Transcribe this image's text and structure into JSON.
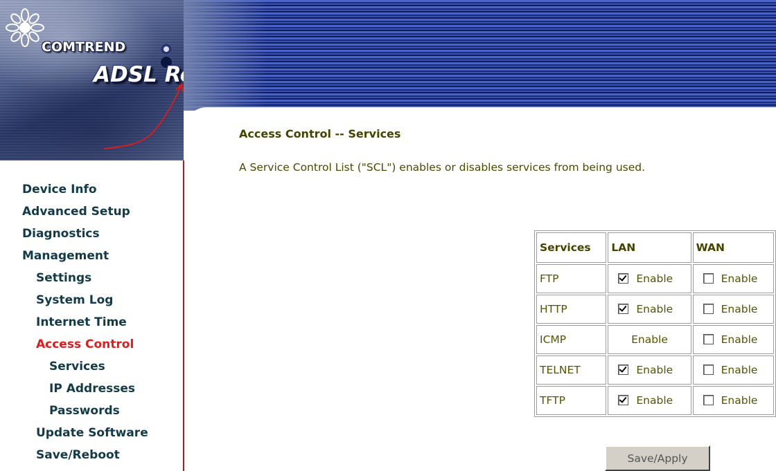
{
  "banner": {
    "brand": "COMTREND",
    "product": "ADSL Router"
  },
  "colors": {
    "nav_text": "#123a48",
    "nav_active": "#e31b1b",
    "content_text": "#4a4a00",
    "sidebar_border": "#b11a1a",
    "stripe_dark": "#1a2b7a",
    "stripe_light": "#4a63c6"
  },
  "sidebar": {
    "items": [
      {
        "label": "Device Info",
        "level": 0,
        "active": false
      },
      {
        "label": "Advanced Setup",
        "level": 0,
        "active": false
      },
      {
        "label": "Diagnostics",
        "level": 0,
        "active": false
      },
      {
        "label": "Management",
        "level": 0,
        "active": false
      },
      {
        "label": "Settings",
        "level": 1,
        "active": false
      },
      {
        "label": "System Log",
        "level": 1,
        "active": false
      },
      {
        "label": "Internet Time",
        "level": 1,
        "active": false
      },
      {
        "label": "Access Control",
        "level": 1,
        "active": true
      },
      {
        "label": "Services",
        "level": 2,
        "active": false
      },
      {
        "label": "IP Addresses",
        "level": 2,
        "active": false
      },
      {
        "label": "Passwords",
        "level": 2,
        "active": false
      },
      {
        "label": "Update Software",
        "level": 1,
        "active": false
      },
      {
        "label": "Save/Reboot",
        "level": 1,
        "active": false
      }
    ]
  },
  "main": {
    "title": "Access Control -- Services",
    "description": "A Service Control List (\"SCL\") enables or disables services from being used.",
    "table": {
      "headers": [
        "Services",
        "LAN",
        "WAN"
      ],
      "enable_label": "Enable",
      "rows": [
        {
          "service": "FTP",
          "lan_checkbox": true,
          "lan_checked": true,
          "wan_checked": false
        },
        {
          "service": "HTTP",
          "lan_checkbox": true,
          "lan_checked": true,
          "wan_checked": false
        },
        {
          "service": "ICMP",
          "lan_checkbox": false,
          "lan_checked": false,
          "wan_checked": false
        },
        {
          "service": "TELNET",
          "lan_checkbox": true,
          "lan_checked": true,
          "wan_checked": false
        },
        {
          "service": "TFTP",
          "lan_checkbox": true,
          "lan_checked": true,
          "wan_checked": false
        }
      ]
    },
    "save_button": "Save/Apply"
  }
}
